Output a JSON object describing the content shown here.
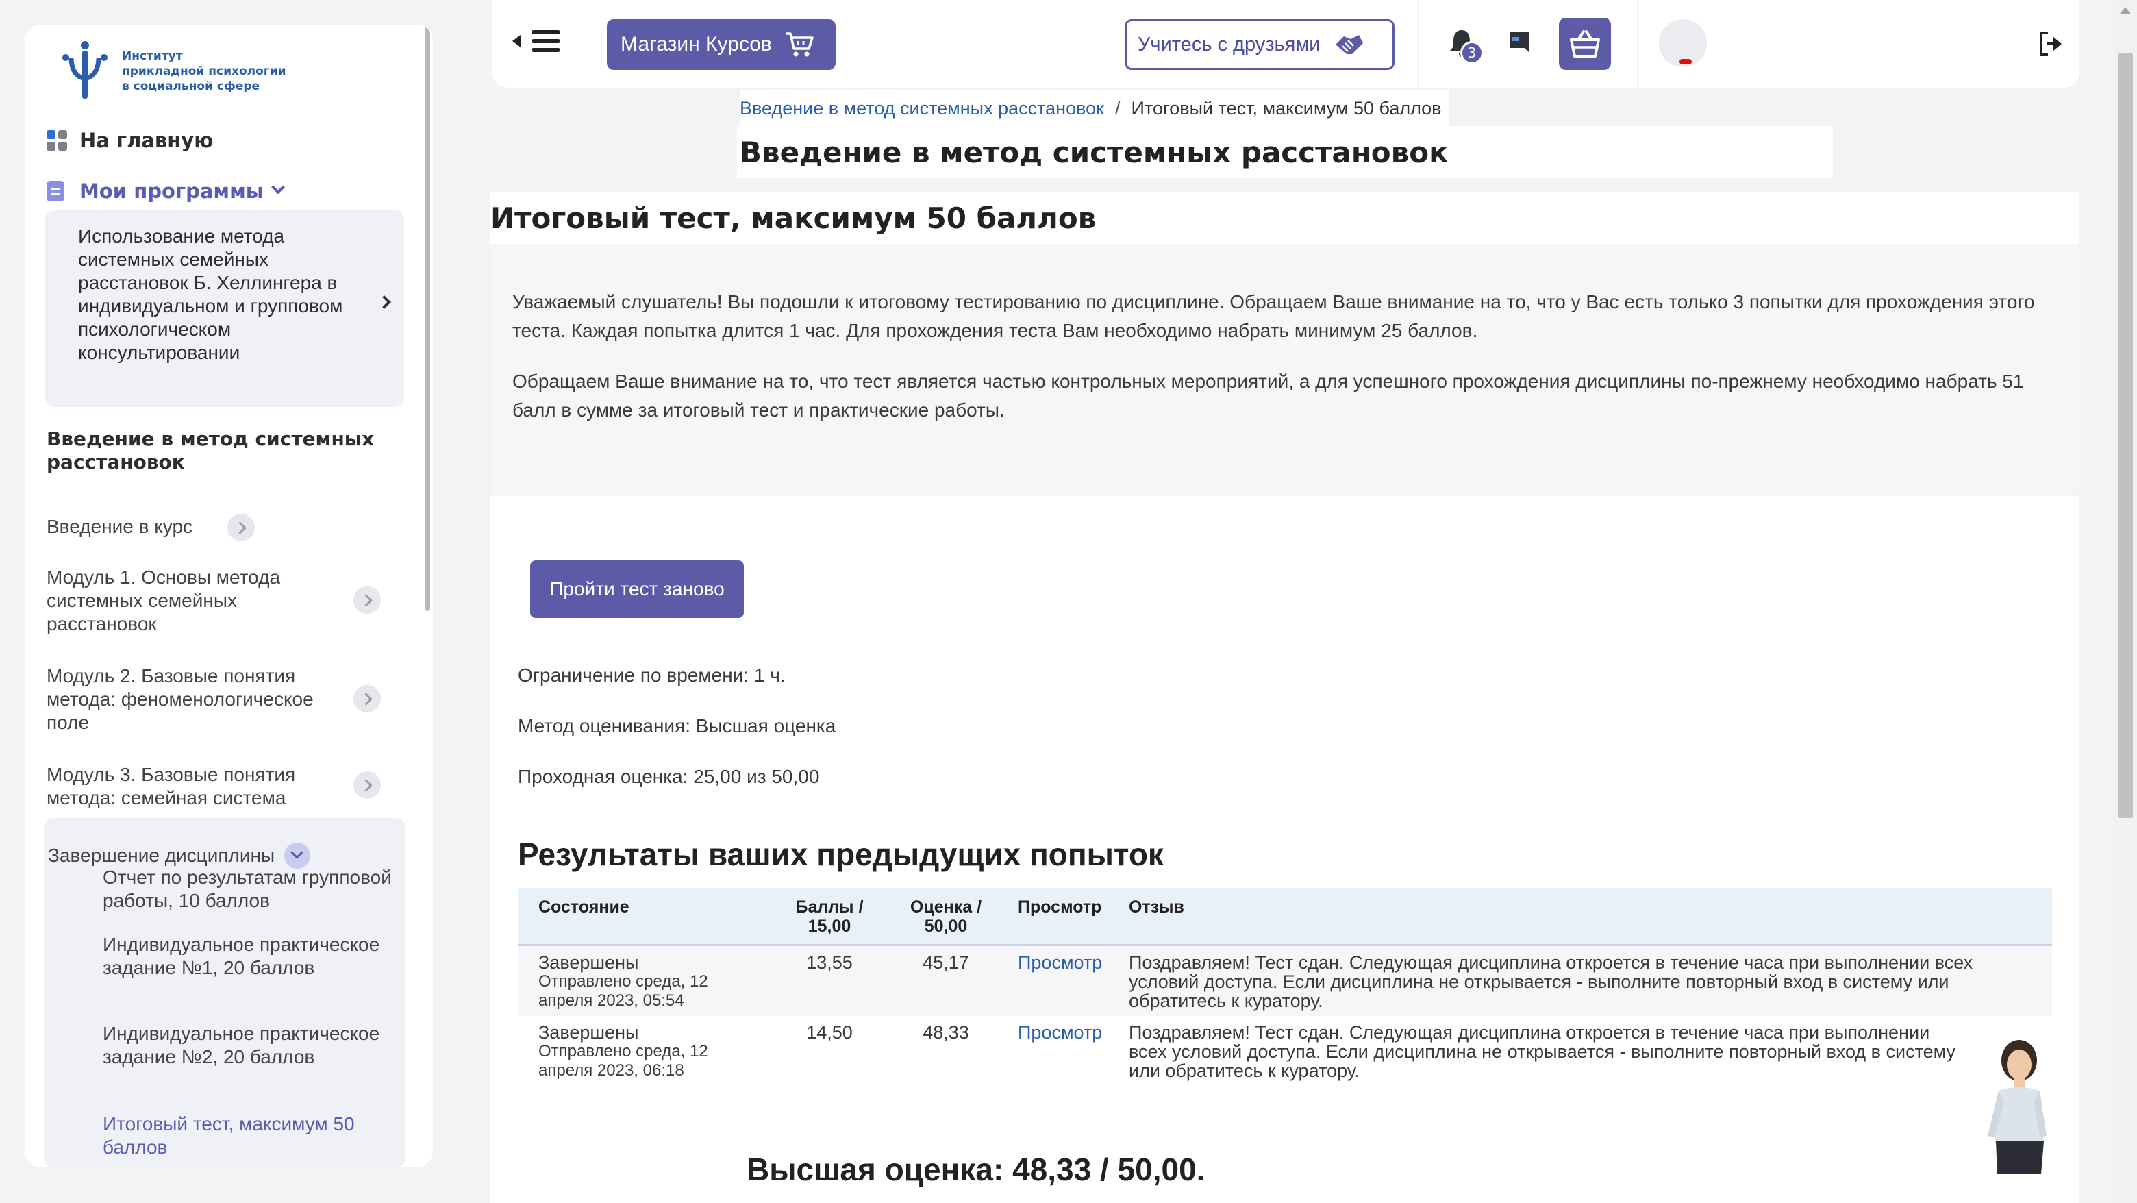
{
  "sidebar": {
    "logo_line1": "Институт",
    "logo_line2": "прикладной психологии",
    "logo_line3": "в социальной сфере",
    "home": "На главную",
    "my_programs": "Мои программы",
    "program": "Использование метода системных семейных расстановок Б. Хеллингера в индивидуальном и групповом психологическом консультировании",
    "course_title": "Введение в метод системных расстановок",
    "modules": [
      "Введение в курс",
      "Модуль 1. Основы метода системных семейных расстановок",
      "Модуль 2. Базовые понятия метода: феноменологическое поле",
      "Модуль 3. Базовые понятия метода: семейная система"
    ],
    "finish_section": "Завершение дисциплины",
    "finish_items": [
      "Отчет по результатам групповой работы, 10 баллов",
      "Индивидуальное практическое задание №1, 20 баллов",
      "Индивидуальное практическое задание №2, 20 баллов",
      "Итоговый тест, максимум 50 баллов"
    ]
  },
  "header": {
    "shop_label": "Магазин Курсов",
    "friends_label": "Учитесь с друзьями",
    "notifications_count": "3"
  },
  "breadcrumb": {
    "course": "Введение в метод системных расстановок",
    "separator": "/",
    "current": "Итоговый тест, максимум 50 баллов"
  },
  "course_heading": "Введение в метод системных расстановок",
  "test_heading": "Итоговый тест, максимум 50 баллов",
  "notice": {
    "p1": "Уважаемый слушатель! Вы подошли к итоговому тестированию по дисциплине. Обращаем Ваше внимание на то, что у Вас есть только 3 попытки для прохождения этого теста.  Каждая попытка длится 1 час. Для прохождения теста Вам необходимо набрать минимум 25 баллов.",
    "p2": "Обращаем Ваше внимание на то, что тест является частью контрольных мероприятий, а для успешного прохождения дисциплины по-прежнему необходимо набрать 51 балл в сумме за итоговый тест и практические работы."
  },
  "retry_label": "Пройти тест заново",
  "info": {
    "time_limit": "Ограничение по времени: 1 ч.",
    "grading": "Метод оценивания: Высшая оценка",
    "pass_grade": "Проходная оценка: 25,00 из 50,00"
  },
  "results": {
    "heading": "Результаты ваших предыдущих попыток",
    "columns": {
      "state": "Состояние",
      "marks_l1": "Баллы /",
      "marks_l2": "15,00",
      "grade_l1": "Оценка /",
      "grade_l2": "50,00",
      "review": "Просмотр",
      "feedback": "Отзыв"
    },
    "rows": [
      {
        "state": "Завершены",
        "submitted": "Отправлено среда, 12 апреля 2023, 05:54",
        "marks": "13,55",
        "grade": "45,17",
        "review": "Просмотр",
        "feedback": "Поздравляем! Тест сдан. Следующая дисциплина откроется в течение часа при выполнении всех условий доступа. Если дисциплина не открывается - выполните повторный вход в систему или обратитесь к куратору."
      },
      {
        "state": "Завершены",
        "submitted": "Отправлено среда, 12 апреля 2023, 06:18",
        "marks": "14,50",
        "grade": "48,33",
        "review": "Просмотр",
        "feedback": "Поздравляем! Тест сдан. Следующая дисциплина откроется в течение часа при выполнении всех условий доступа. Если дисциплина не открывается - выполните повторный вход в систему или обратитесь к куратору."
      }
    ]
  },
  "best_grade": "Высшая оценка: 48,33 / 50,00.",
  "colors": {
    "accent": "#5b5ba8",
    "link": "#2a5ea8",
    "table_header": "#e8f0f8"
  }
}
